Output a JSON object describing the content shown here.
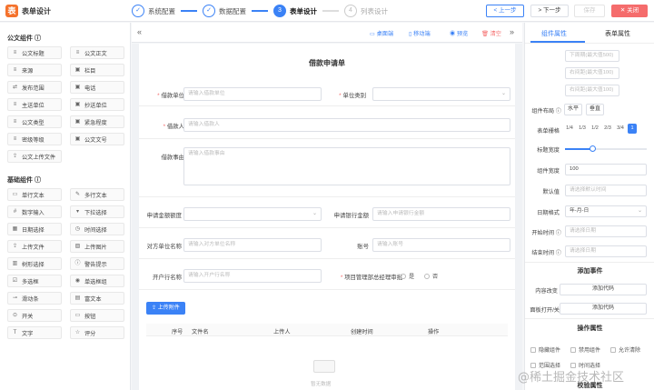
{
  "app": {
    "logo": "表",
    "title": "表单设计"
  },
  "steps": [
    {
      "index": "✓",
      "label": "系统配置",
      "state": "done"
    },
    {
      "index": "✓",
      "label": "数据配置",
      "state": "done"
    },
    {
      "index": "3",
      "label": "表单设计",
      "state": "active"
    },
    {
      "index": "4",
      "label": "列表设计",
      "state": "todo"
    }
  ],
  "topbar": {
    "prev": "< 上一步",
    "next": "> 下一步",
    "save": "保存",
    "close": "✕ 关闭"
  },
  "left": {
    "public_title": "公文组件 ⓘ",
    "public_items": [
      {
        "icon": "≡",
        "label": "公文标题"
      },
      {
        "icon": "≡",
        "label": "公文正文"
      },
      {
        "icon": "≡",
        "label": "来源"
      },
      {
        "icon": "▣",
        "label": "栏目"
      },
      {
        "icon": "⇄",
        "label": "发布范围"
      },
      {
        "icon": "▣",
        "label": "电话"
      },
      {
        "icon": "≡",
        "label": "主送单位"
      },
      {
        "icon": "▣",
        "label": "抄送单位"
      },
      {
        "icon": "≡",
        "label": "公文类型"
      },
      {
        "icon": "▣",
        "label": "紧急程度"
      },
      {
        "icon": "≡",
        "label": "密级等级"
      },
      {
        "icon": "▣",
        "label": "公文文号"
      },
      {
        "icon": "⇪",
        "label": "公文上传文件"
      }
    ],
    "basic_title": "基础组件 ⓘ",
    "basic_items": [
      {
        "icon": "▭",
        "label": "单行文本"
      },
      {
        "icon": "✎",
        "label": "多行文本"
      },
      {
        "icon": "#",
        "label": "数字输入"
      },
      {
        "icon": "▾",
        "label": "下拉选择"
      },
      {
        "icon": "▦",
        "label": "日期选择"
      },
      {
        "icon": "◷",
        "label": "时间选择"
      },
      {
        "icon": "⇪",
        "label": "上传文件"
      },
      {
        "icon": "▨",
        "label": "上传图片"
      },
      {
        "icon": "▥",
        "label": "树形选择"
      },
      {
        "icon": "ⓘ",
        "label": "警告提示"
      },
      {
        "icon": "☑",
        "label": "多选框"
      },
      {
        "icon": "◉",
        "label": "单选框组"
      },
      {
        "icon": "⊸",
        "label": "滑动条"
      },
      {
        "icon": "▤",
        "label": "富文本"
      },
      {
        "icon": "⊙",
        "label": "开关"
      },
      {
        "icon": "▭",
        "label": "按钮"
      },
      {
        "icon": "T",
        "label": "文字"
      },
      {
        "icon": "☆",
        "label": "评分"
      }
    ]
  },
  "toolbar": {
    "collapse_left": "«",
    "desktop": "▭ 桌面端",
    "mobile": "▯ 移动端",
    "preview": "◉ 预览",
    "clear": "🗑 清空",
    "collapse_right": "»"
  },
  "form": {
    "title": "借款申请单",
    "fields": {
      "borrow_unit": {
        "label": "借款单位",
        "placeholder": "请输入借款单位"
      },
      "unit_type": {
        "label": "单位类别",
        "placeholder": ""
      },
      "borrower": {
        "label": "借款人",
        "placeholder": "请输入借款人"
      },
      "reason": {
        "label": "借款事由",
        "placeholder": "请输入借款事由"
      },
      "amount": {
        "label": "申请金额额度",
        "placeholder": ""
      },
      "bank_amount": {
        "label": "申请银行金额",
        "placeholder": "请输入申请银行金额"
      },
      "counter_unit": {
        "label": "对方单位名称",
        "placeholder": "请输入对方单位名称"
      },
      "account": {
        "label": "账号",
        "placeholder": "请输入账号"
      },
      "bank_name": {
        "label": "开户行名称",
        "placeholder": "请输入开户行名称"
      },
      "manager_approve": {
        "label": "项目管理部总经理审批",
        "yes": "是",
        "no": "否"
      }
    },
    "upload": {
      "button": "⇪ 上传附件",
      "columns": [
        "序号",
        "文件名",
        "上传人",
        "创建时间",
        "操作"
      ],
      "empty": "暂无数据"
    }
  },
  "right": {
    "tabs": [
      "组件属性",
      "表单属性"
    ],
    "top_inputs": [
      "下周期(最大值500)",
      "右间距(最大值100)",
      "右间距(最大值100)"
    ],
    "layout_label": "组件布局 ⓘ",
    "layout_options": [
      "水平",
      "垂直"
    ],
    "grid_label": "表单栅格",
    "grid_options": [
      "1/4",
      "1/3",
      "1/2",
      "2/3",
      "3/4",
      "1"
    ],
    "title_width_label": "标题宽度",
    "comp_width_label": "组件宽度",
    "comp_width_value": "100",
    "default_label": "默认值",
    "default_placeholder": "请选择默认时间",
    "date_format_label": "日期格式",
    "date_format_value": "年-月-日",
    "start_label": "开始时间 ⓘ",
    "start_placeholder": "请选择日期",
    "end_label": "结束时间 ⓘ",
    "end_placeholder": "请选择日期",
    "events_title": "添加事件",
    "content_change_label": "内容改变",
    "content_change_btn": "添加代码",
    "panel_toggle_label": "面板打开/关",
    "panel_toggle_btn": "添加代码",
    "ops_title": "操作属性",
    "ops": [
      "隐藏组件",
      "禁用组件",
      "允许清除",
      "范围选择",
      "时间选择"
    ],
    "verify_title": "校验属性"
  },
  "watermark": "@稀土掘金技术社区"
}
